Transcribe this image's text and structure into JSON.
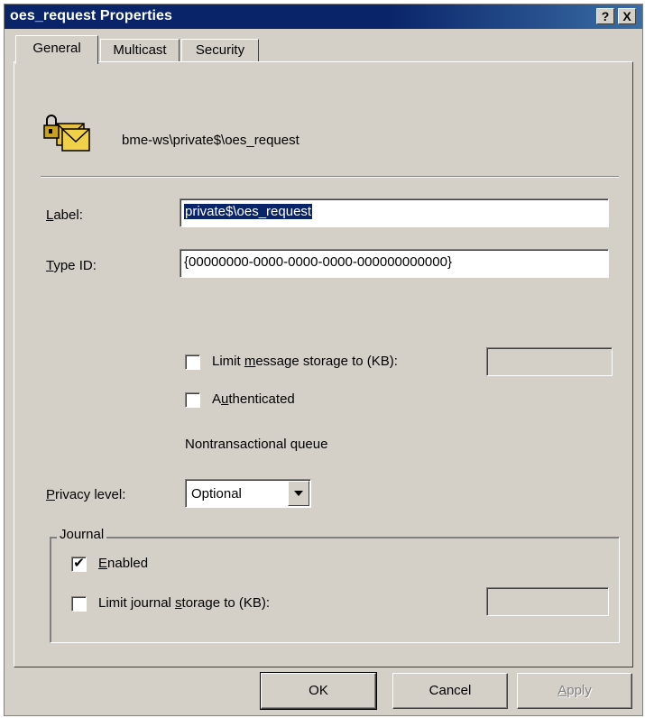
{
  "window": {
    "title": "oes_request Properties"
  },
  "caption_buttons": {
    "help": "?",
    "close": "X"
  },
  "tabs": [
    {
      "label": "General"
    },
    {
      "label": "Multicast"
    },
    {
      "label": "Security"
    }
  ],
  "queue": {
    "icon": "queue-envelope-lock-icon",
    "path": "bme-ws\\private$\\oes_request"
  },
  "label_field": {
    "label_first": "L",
    "label_rest": "abel:",
    "value": "private$\\oes_request"
  },
  "typeid_field": {
    "label_first": "T",
    "label_rest": "ype ID:",
    "value": "{00000000-0000-0000-0000-000000000000}"
  },
  "limit_message": {
    "label_pre": "Limit ",
    "label_key": "m",
    "label_post": "essage storage to (KB):",
    "checked": false,
    "value": ""
  },
  "authenticated": {
    "label_pre": "A",
    "label_key": "u",
    "label_post": "thenticated",
    "checked": false
  },
  "transaction_status": "Nontransactional queue",
  "privacy": {
    "label_first": "P",
    "label_rest": "rivacy level:",
    "selected": "Optional"
  },
  "journal": {
    "title": "Journal",
    "enabled": {
      "label_key": "E",
      "label_rest": "nabled",
      "checked": true,
      "mark": "✔"
    },
    "limit": {
      "label_pre": "Limit journal ",
      "label_key": "s",
      "label_post": "torage to (KB):",
      "checked": false,
      "value": ""
    }
  },
  "buttons": {
    "ok": "OK",
    "cancel": "Cancel",
    "apply_first": "A",
    "apply_rest": "pply"
  }
}
